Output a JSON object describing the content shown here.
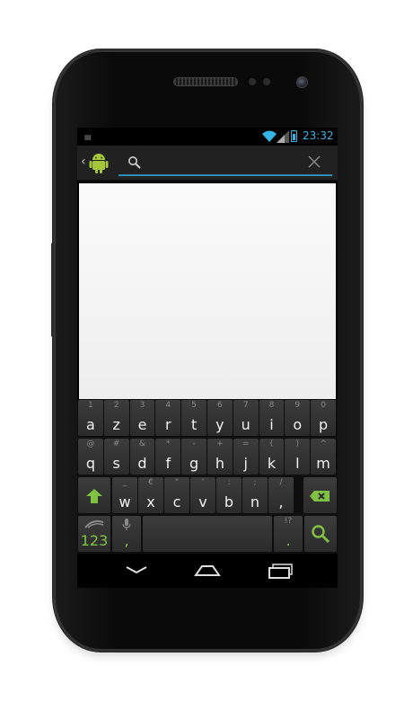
{
  "status_bar": {
    "time": "23:32",
    "accent_color": "#33b5e5"
  },
  "action_bar": {
    "back_glyph": "‹",
    "app_icon": "android-icon",
    "search": {
      "value": "",
      "placeholder": ""
    }
  },
  "keyboard": {
    "accent_color": "#7fc242",
    "row1": [
      {
        "main": "a",
        "sub": "1"
      },
      {
        "main": "z",
        "sub": "2"
      },
      {
        "main": "e",
        "sub": "3"
      },
      {
        "main": "r",
        "sub": "4"
      },
      {
        "main": "t",
        "sub": "5"
      },
      {
        "main": "y",
        "sub": "6"
      },
      {
        "main": "u",
        "sub": "7"
      },
      {
        "main": "i",
        "sub": "8"
      },
      {
        "main": "o",
        "sub": "9"
      },
      {
        "main": "p",
        "sub": "0"
      }
    ],
    "row2": [
      {
        "main": "q",
        "sub": "@"
      },
      {
        "main": "s",
        "sub": "#"
      },
      {
        "main": "d",
        "sub": "&"
      },
      {
        "main": "f",
        "sub": "*"
      },
      {
        "main": "g",
        "sub": "-"
      },
      {
        "main": "h",
        "sub": "+"
      },
      {
        "main": "j",
        "sub": "="
      },
      {
        "main": "k",
        "sub": "("
      },
      {
        "main": "l",
        "sub": ")"
      },
      {
        "main": "m",
        "sub": "^"
      }
    ],
    "row3": [
      {
        "main": "w",
        "sub": "_"
      },
      {
        "main": "x",
        "sub": "€"
      },
      {
        "main": "c",
        "sub": "\""
      },
      {
        "main": "v",
        "sub": "'"
      },
      {
        "main": "b",
        "sub": ":"
      },
      {
        "main": "n",
        "sub": ";"
      },
      {
        "main": ",",
        "sub": "/"
      }
    ],
    "row4": {
      "symbols_label": "123",
      "comma_label": ",",
      "period_label": ".",
      "period_sub": "!?"
    }
  }
}
